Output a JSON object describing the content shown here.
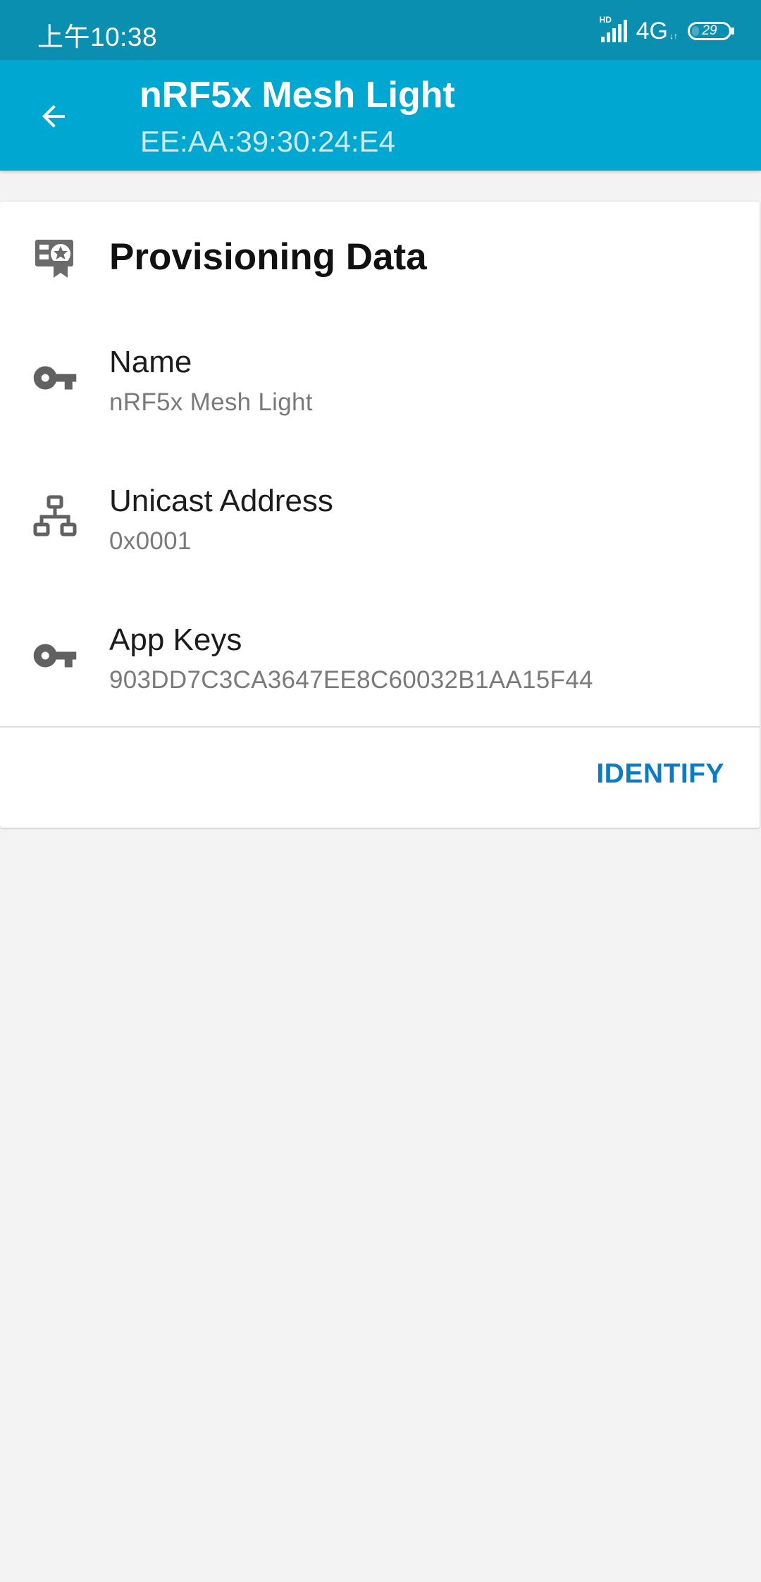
{
  "status_bar": {
    "time": "上午10:38",
    "hd_label": "HD",
    "network": "4G",
    "battery": "29",
    "battery_level": 0.29,
    "color": "#0a8fb0"
  },
  "app_bar": {
    "title": "nRF5x Mesh Light",
    "subtitle": "EE:AA:39:30:24:E4",
    "color": "#00a7d0",
    "back_icon": "arrow-back-icon"
  },
  "card": {
    "title": "Provisioning Data",
    "header_icon": "provisioning-badge-icon",
    "rows": [
      {
        "title": "Name",
        "value": "nRF5x Mesh Light",
        "icon": "key-icon"
      },
      {
        "title": "Unicast Address",
        "value": "0x0001",
        "icon": "network-icon"
      },
      {
        "title": "App Keys",
        "value": "903DD7C3CA3647EE8C60032B1AA15F44",
        "icon": "key-icon"
      }
    ],
    "action_label": "IDENTIFY",
    "action_color": "#0a7cc4"
  }
}
